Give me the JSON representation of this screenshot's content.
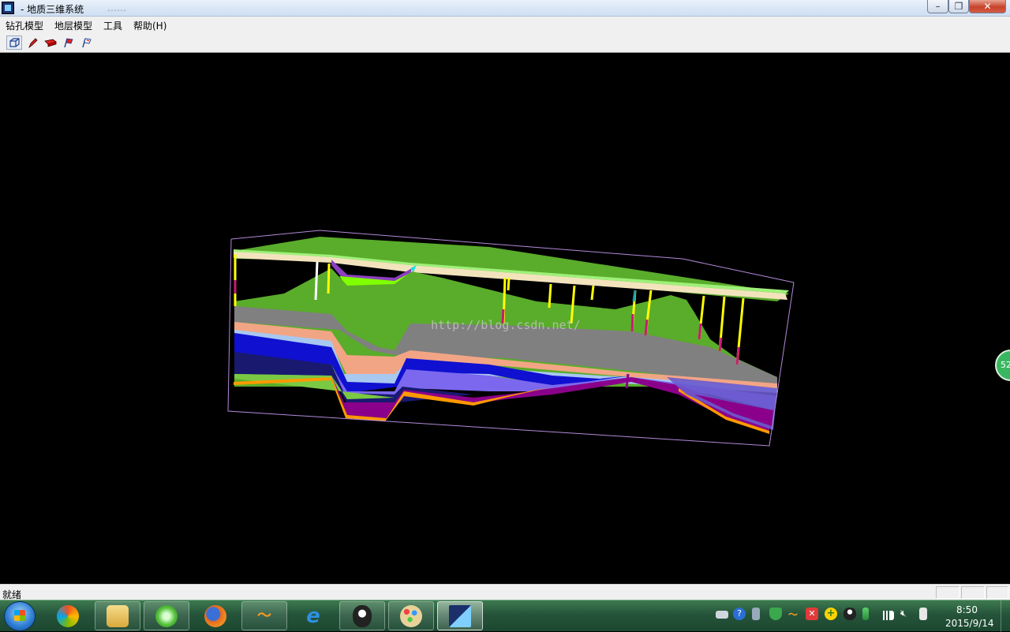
{
  "window": {
    "title": "- 地质三维系统",
    "title_extra": "……"
  },
  "menu": {
    "items": [
      "钻孔模型",
      "地层模型",
      "工具",
      "帮助(H)"
    ]
  },
  "toolbar": {
    "buttons": [
      "box-view-icon",
      "drill-pen-icon",
      "layer-red-icon",
      "flag-red-icon",
      "flag-white-icon"
    ]
  },
  "viewport": {
    "watermark": "http://blog.csdn.net/",
    "badge": "52"
  },
  "status": {
    "text": "就绪"
  },
  "taskbar": {
    "apps": [
      {
        "name": "photo-viewer-icon",
        "color": "#e9c34b"
      },
      {
        "name": "file-explorer-icon",
        "color": "#e5c46a"
      },
      {
        "name": "green-refresh-icon",
        "color": "#55c23c"
      },
      {
        "name": "firefox-icon",
        "color": "#e66b1e"
      },
      {
        "name": "wo-app-icon",
        "color": "#e88a1f"
      },
      {
        "name": "ie-icon",
        "color": "#2f8fe0"
      },
      {
        "name": "qq-icon",
        "color": "#222222"
      },
      {
        "name": "paint-icon",
        "color": "#d9a84b"
      },
      {
        "name": "geology-app-icon",
        "color": "#1b2f6b"
      }
    ],
    "tray": [
      "keyboard-icon",
      "help-icon",
      "network-icon",
      "shield-icon",
      "wo-tray-icon",
      "red-x-icon",
      "plus-icon",
      "qq-tray-icon",
      "wifi-signal-icon",
      "volume-mute-icon",
      "battery-icon"
    ],
    "time": "8:50",
    "date": "2015/9/14"
  }
}
